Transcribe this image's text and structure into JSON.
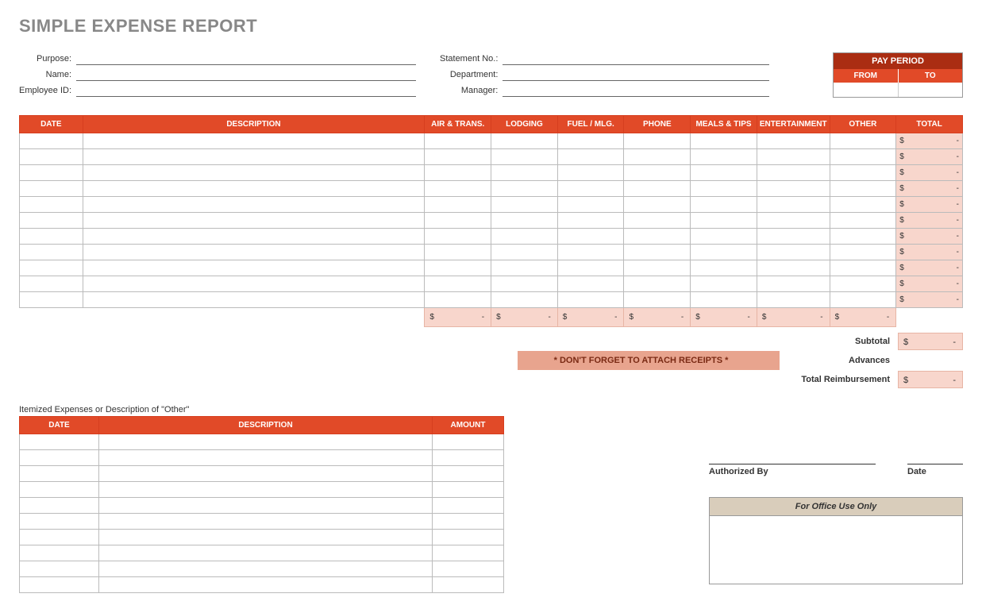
{
  "title": "SIMPLE EXPENSE REPORT",
  "meta_left": {
    "purpose_lbl": "Purpose:",
    "name_lbl": "Name:",
    "empid_lbl": "Employee ID:"
  },
  "meta_mid": {
    "stmt_lbl": "Statement No.:",
    "dept_lbl": "Department:",
    "mgr_lbl": "Manager:"
  },
  "pay_period": {
    "title": "PAY PERIOD",
    "from": "FROM",
    "to": "TO",
    "from_val": "",
    "to_val": ""
  },
  "main_headers": {
    "date": "DATE",
    "desc": "DESCRIPTION",
    "air": "AIR & TRANS.",
    "lodging": "LODGING",
    "fuel": "FUEL / MLG.",
    "phone": "PHONE",
    "meals": "MEALS & TIPS",
    "ent": "ENTERTAINMENT",
    "other": "OTHER",
    "total": "TOTAL"
  },
  "row_total": {
    "sym": "$",
    "val": "-"
  },
  "col_sum": {
    "sym": "$",
    "val": "-"
  },
  "summary": {
    "subtotal_lbl": "Subtotal",
    "advances_lbl": "Advances",
    "reimb_lbl": "Total Reimbursement",
    "sym": "$",
    "val": "-"
  },
  "reminder": "* DON'T FORGET TO ATTACH RECEIPTS *",
  "itemized_label": "Itemized Expenses or Description of \"Other\"",
  "item_headers": {
    "date": "DATE",
    "desc": "DESCRIPTION",
    "amt": "AMOUNT"
  },
  "auth": {
    "by": "Authorized By",
    "date": "Date"
  },
  "office_title": "For Office Use Only"
}
